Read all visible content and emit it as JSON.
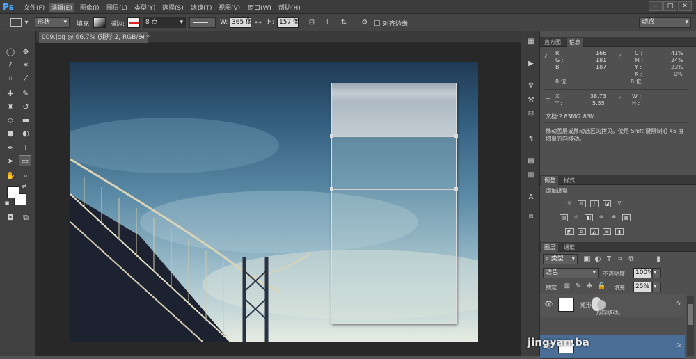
{
  "app": {
    "logo": "Ps"
  },
  "menu": [
    "文件(F)",
    "编辑(E)",
    "图像(I)",
    "图层(L)",
    "类型(Y)",
    "选择(S)",
    "滤镜(T)",
    "视图(V)",
    "窗口(W)",
    "帮助(H)"
  ],
  "window_buttons": [
    "—",
    "□",
    "✕"
  ],
  "options_bar": {
    "mode": "形状",
    "fill_label": "填充:",
    "stroke_label": "描边:",
    "stroke_width": "8 点",
    "w_label": "W:",
    "w_value": "365 像",
    "h_label": "H:",
    "h_value": "157 像",
    "align_edges_label": "对齐边缘",
    "workspace": "动感"
  },
  "document": {
    "tab_title": "009.jpg @ 66.7% (矩形 2, RGB/8) *",
    "close_glyph": "×"
  },
  "info_panel": {
    "tabs": [
      "直方图",
      "信息"
    ],
    "r_label": "R :",
    "r": "166",
    "g_label": "G :",
    "g": "181",
    "b_label": "B :",
    "b": "187",
    "c_label": "C :",
    "c": "41%",
    "m_label": "M :",
    "m": "24%",
    "y_label": "Y :",
    "y": "23%",
    "k_label": "K :",
    "k": "0%",
    "bits_left": "8 位",
    "bits_right": "8 位",
    "x_label": "X :",
    "x": "38.73",
    "yy_label": "Y :",
    "yy": "5.55",
    "w_label": "W :",
    "h_label": "H :",
    "doc_size": "文档:2.83M/2.83M",
    "hint": "移动图层或移动选区的拷贝。使用 Shift 键限制沿 45 度增量方向移动。"
  },
  "adjust_panel": {
    "tabs": [
      "调整",
      "样式"
    ],
    "title": "添加调整"
  },
  "layers_panel": {
    "tabs": [
      "图层",
      "通道"
    ],
    "filter": "类型",
    "blend_mode": "滤色",
    "opacity_label": "不透明度:",
    "opacity": "100%",
    "lock_label": "锁定:",
    "fill_label": "填充:",
    "fill": "25%",
    "layer1_name": "矩形2拷贝",
    "fx_label": "fx",
    "overlay_text": "方向移动。",
    "watermark": "jingyan.ba"
  },
  "colors": {
    "accent": "#4aa8ff",
    "panel": "#505050",
    "dark": "#282828"
  }
}
